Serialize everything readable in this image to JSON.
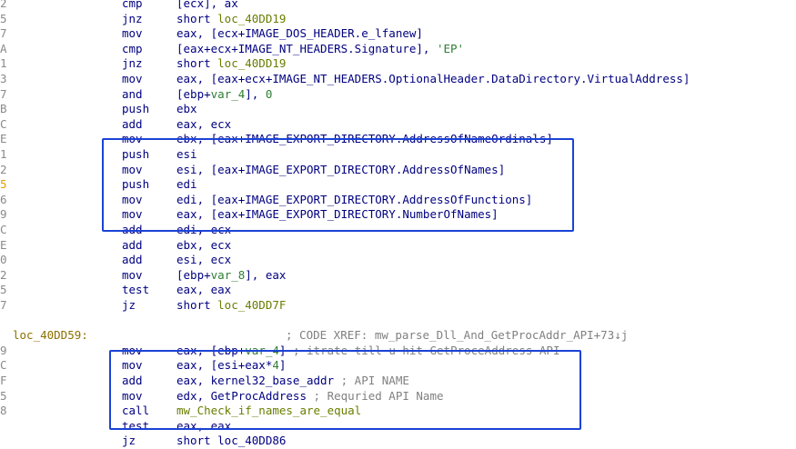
{
  "theme": {
    "box_color": "#1a43d6",
    "mnemonic_color": "#000080",
    "name_color": "#6a7d00",
    "comment_color": "#808080"
  },
  "lines": [
    {
      "g": "2",
      "m": "cmp",
      "segs": [
        {
          "t": "[ecx], ax",
          "c": ""
        }
      ]
    },
    {
      "g": "5",
      "m": "jnz",
      "segs": [
        {
          "t": "short ",
          "c": ""
        },
        {
          "t": "loc_40DD19",
          "c": "loc"
        }
      ]
    },
    {
      "g": "7",
      "m": "mov",
      "segs": [
        {
          "t": "eax, [ecx+IMAGE_DOS_HEADER.e_lfanew]",
          "c": ""
        }
      ]
    },
    {
      "g": "A",
      "m": "cmp",
      "segs": [
        {
          "t": "[eax+ecx+IMAGE_NT_HEADERS.Signature], ",
          "c": ""
        },
        {
          "t": "'EP'",
          "c": "str"
        }
      ]
    },
    {
      "g": "1",
      "m": "jnz",
      "segs": [
        {
          "t": "short ",
          "c": ""
        },
        {
          "t": "loc_40DD19",
          "c": "loc"
        }
      ]
    },
    {
      "g": "3",
      "m": "mov",
      "segs": [
        {
          "t": "eax, [eax+ecx+IMAGE_NT_HEADERS.OptionalHeader.DataDirectory.VirtualAddress]",
          "c": ""
        }
      ]
    },
    {
      "g": "7",
      "m": "and",
      "segs": [
        {
          "t": "[ebp+",
          "c": ""
        },
        {
          "t": "var_4",
          "c": "var"
        },
        {
          "t": "], ",
          "c": ""
        },
        {
          "t": "0",
          "c": "num"
        }
      ]
    },
    {
      "g": "B",
      "m": "push",
      "segs": [
        {
          "t": "ebx",
          "c": ""
        }
      ]
    },
    {
      "g": "C",
      "m": "add",
      "segs": [
        {
          "t": "eax, ecx",
          "c": ""
        }
      ]
    },
    {
      "g": "E",
      "m": "mov",
      "segs": [
        {
          "t": "ebx, [eax+IMAGE_EXPORT_DIRECTORY.AddressOfNameOrdinals]",
          "c": ""
        }
      ]
    },
    {
      "g": "1",
      "m": "push",
      "segs": [
        {
          "t": "esi",
          "c": ""
        }
      ]
    },
    {
      "g": "2",
      "m": "mov",
      "segs": [
        {
          "t": "esi, [eax+IMAGE_EXPORT_DIRECTORY.AddressOfNames]",
          "c": ""
        }
      ]
    },
    {
      "g": "5",
      "m": "push",
      "segs": [
        {
          "t": "edi",
          "c": ""
        }
      ],
      "hl": true
    },
    {
      "g": "6",
      "m": "mov",
      "segs": [
        {
          "t": "edi, [eax+IMAGE_EXPORT_DIRECTORY.AddressOfFunctions]",
          "c": ""
        }
      ]
    },
    {
      "g": "9",
      "m": "mov",
      "segs": [
        {
          "t": "eax, [eax+IMAGE_EXPORT_DIRECTORY.NumberOfNames]",
          "c": ""
        }
      ]
    },
    {
      "g": "C",
      "m": "add",
      "segs": [
        {
          "t": "edi, ecx",
          "c": ""
        }
      ]
    },
    {
      "g": "E",
      "m": "add",
      "segs": [
        {
          "t": "ebx, ecx",
          "c": ""
        }
      ]
    },
    {
      "g": "0",
      "m": "add",
      "segs": [
        {
          "t": "esi, ecx",
          "c": ""
        }
      ]
    },
    {
      "g": "2",
      "m": "mov",
      "segs": [
        {
          "t": "[ebp+",
          "c": ""
        },
        {
          "t": "var_8",
          "c": "var"
        },
        {
          "t": "], eax",
          "c": ""
        }
      ]
    },
    {
      "g": "5",
      "m": "test",
      "segs": [
        {
          "t": "eax, eax",
          "c": ""
        }
      ]
    },
    {
      "g": "7",
      "m": "jz",
      "segs": [
        {
          "t": "short ",
          "c": ""
        },
        {
          "t": "loc_40DD7F",
          "c": "loc"
        }
      ]
    },
    {
      "g": "",
      "m": "",
      "segs": []
    },
    {
      "g": "",
      "label": "loc_40DD59:",
      "xref": "; CODE XREF: mw_parse_Dll_And_GetProcAddr_API+73↓j",
      "m": "",
      "segs": []
    },
    {
      "g": "9",
      "m": "mov",
      "segs": [
        {
          "t": "eax, [ebp+",
          "c": ""
        },
        {
          "t": "var_4",
          "c": "var"
        },
        {
          "t": "] ",
          "c": ""
        },
        {
          "t": "; itrate till u hit GetProceAddress API",
          "c": ""
        }
      ]
    },
    {
      "g": "C",
      "m": "mov",
      "segs": [
        {
          "t": "eax, [esi+eax*",
          "c": ""
        },
        {
          "t": "4",
          "c": "num"
        },
        {
          "t": "]",
          "c": ""
        }
      ]
    },
    {
      "g": "F",
      "m": "add",
      "segs": [
        {
          "t": "eax, kernel32_base_addr ",
          "c": ""
        },
        {
          "t": "; API NAME",
          "c": ""
        }
      ]
    },
    {
      "g": "5",
      "m": "mov",
      "segs": [
        {
          "t": "edx, GetProcAddress ",
          "c": ""
        },
        {
          "t": "; Requried API Name",
          "c": ""
        }
      ]
    },
    {
      "g": "8",
      "m": "call",
      "segs": [
        {
          "t": "mw_Check_if_names_are_equal",
          "c": "loc"
        }
      ]
    },
    {
      "g": "",
      "m": "test",
      "segs": [
        {
          "t": "eax, eax",
          "c": ""
        }
      ]
    },
    {
      "g": "",
      "m": "jz",
      "segs": [
        {
          "t": "short loc_40DD86",
          "c": ""
        }
      ]
    }
  ]
}
